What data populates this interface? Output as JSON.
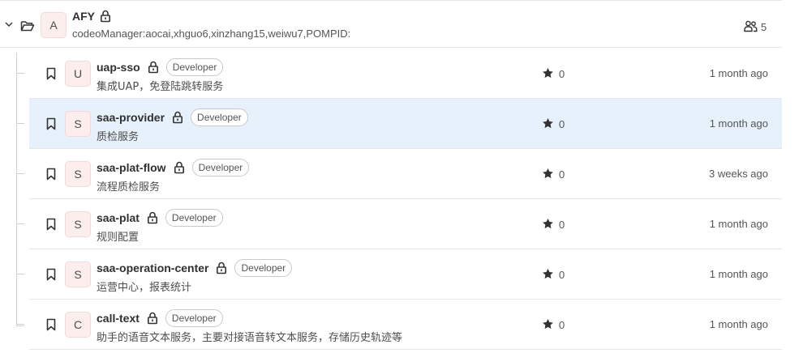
{
  "group": {
    "avatar_letter": "A",
    "name": "AFY",
    "description": "codeoManager:aocai,xhguo6,xinzhang15,weiwu7,POMPID:",
    "member_count": "5"
  },
  "projects": [
    {
      "avatar_letter": "U",
      "name": "uap-sso",
      "role": "Developer",
      "description": "集成UAP，免登陆跳转服务",
      "stars": "0",
      "updated": "1 month ago",
      "highlighted": false
    },
    {
      "avatar_letter": "S",
      "name": "saa-provider",
      "role": "Developer",
      "description": "质检服务",
      "stars": "0",
      "updated": "1 month ago",
      "highlighted": true
    },
    {
      "avatar_letter": "S",
      "name": "saa-plat-flow",
      "role": "Developer",
      "description": "流程质检服务",
      "stars": "0",
      "updated": "3 weeks ago",
      "highlighted": false
    },
    {
      "avatar_letter": "S",
      "name": "saa-plat",
      "role": "Developer",
      "description": "规则配置",
      "stars": "0",
      "updated": "1 month ago",
      "highlighted": false
    },
    {
      "avatar_letter": "S",
      "name": "saa-operation-center",
      "role": "Developer",
      "description": "运营中心，报表统计",
      "stars": "0",
      "updated": "1 month ago",
      "highlighted": false
    },
    {
      "avatar_letter": "C",
      "name": "call-text",
      "role": "Developer",
      "description": "助手的语音文本服务，主要对接语音转文本服务，存储历史轨迹等",
      "stars": "0",
      "updated": "1 month ago",
      "highlighted": false
    }
  ],
  "icons": {
    "caret": "chevron-down-icon",
    "folder": "folder-open-icon",
    "lock": "lock-icon",
    "members": "users-icon",
    "bookmark": "bookmark-icon",
    "star": "star-icon"
  },
  "colors": {
    "highlight_row": "#e6f1fb",
    "avatar_bg": "#fbeeec"
  }
}
